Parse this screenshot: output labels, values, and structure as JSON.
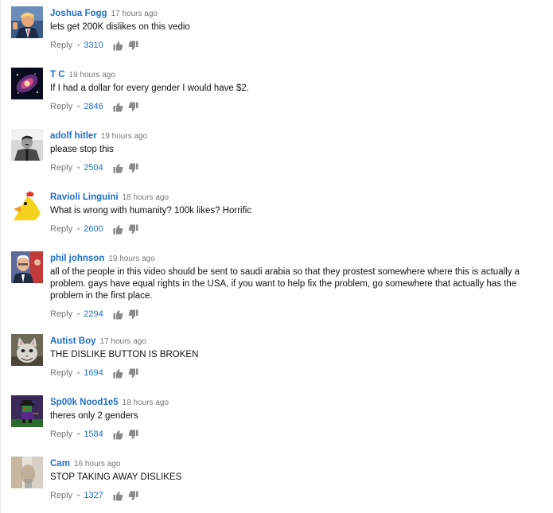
{
  "comments": [
    {
      "author": "Joshua Fogg",
      "time": "17 hours ago",
      "text": "lets get 200K dislikes on  this vedio",
      "reply": "Reply",
      "likes": "3310",
      "avatar": "trump-photo-avatar"
    },
    {
      "author": "T C",
      "time": "19 hours ago",
      "text": "If I had a dollar for every gender I would have $2.",
      "reply": "Reply",
      "likes": "2846",
      "avatar": "galaxy-avatar"
    },
    {
      "author": "adolf hitler",
      "time": "19 hours ago",
      "text": "please stop this",
      "reply": "Reply",
      "likes": "2504",
      "avatar": "bw-photo-avatar"
    },
    {
      "author": "Ravioli Linguini",
      "time": "18 hours ago",
      "text": "What is wrong with humanity? 100k likes? Horrific",
      "reply": "Reply",
      "likes": "2600",
      "avatar": "yellow-bird-avatar"
    },
    {
      "author": "phil johnson",
      "time": "19 hours ago",
      "text": "all of the people in this video should be sent to saudi arabia so that they prostest somewhere where this is actually a problem. gays have equal rights in the USA, if you want to help fix the problem, go somewhere that actually has the problem in the first place.",
      "reply": "Reply",
      "likes": "2294",
      "avatar": "politician-photo-avatar"
    },
    {
      "author": "Autist Boy",
      "time": "17 hours ago",
      "text": "THE DISLIKE BUTTON IS BROKEN",
      "reply": "Reply",
      "likes": "1694",
      "avatar": "cat-photo-avatar"
    },
    {
      "author": "Sp00k Nood1e5",
      "time": "18 hours ago",
      "text": "theres only 2 genders",
      "reply": "Reply",
      "likes": "1584",
      "avatar": "pixel-character-avatar"
    },
    {
      "author": "Cam",
      "time": "16 hours ago",
      "text": "STOP TAKING AWAY DISLIKES",
      "reply": "Reply",
      "likes": "1327",
      "avatar": "blurry-photo-avatar"
    }
  ],
  "colors": {
    "author": "#1f6fcb",
    "meta": "#767676",
    "text": "#111111"
  }
}
